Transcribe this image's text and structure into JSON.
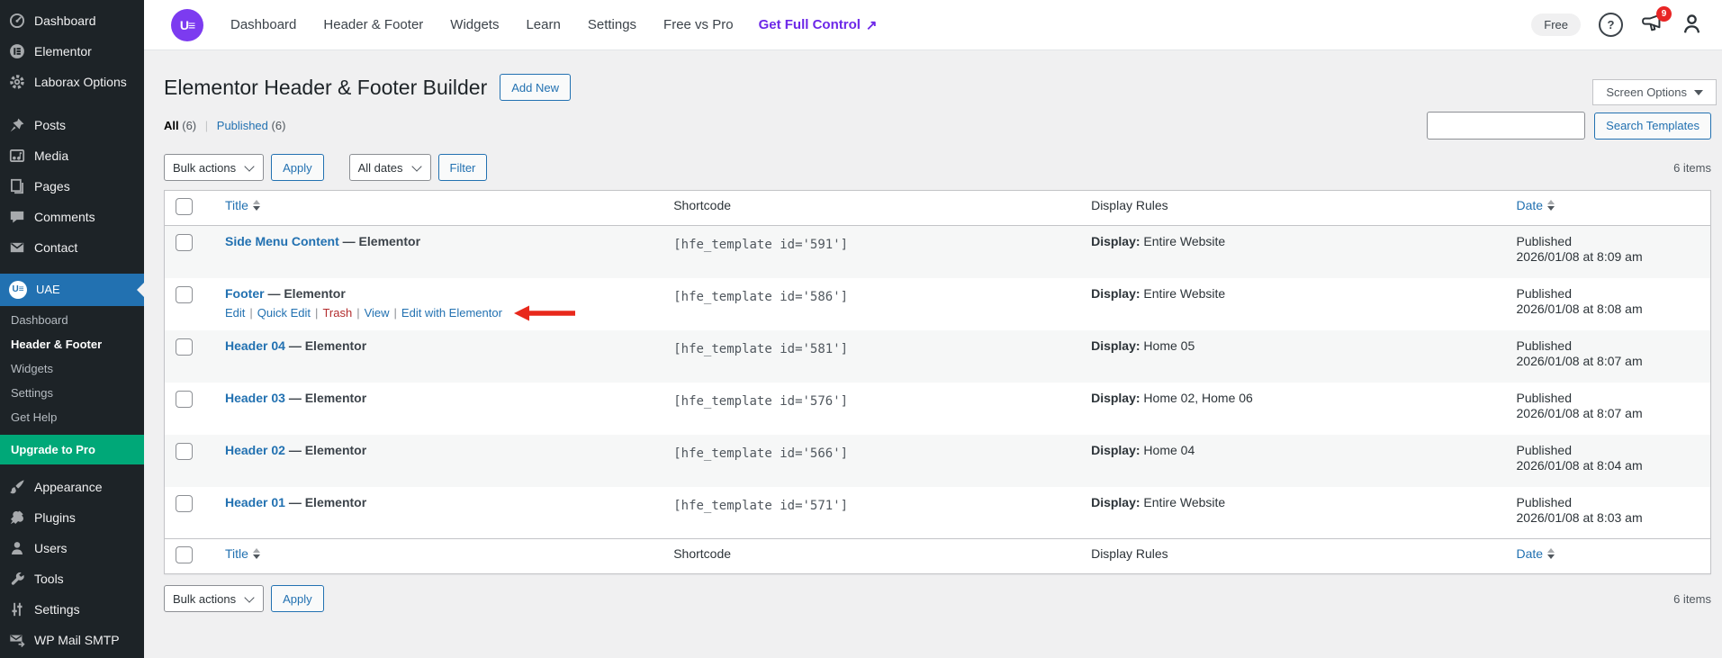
{
  "colors": {
    "accent": "#2271b1",
    "purple": "#7c3bf0",
    "purple_text": "#6d28e8",
    "green": "#00a878",
    "red_badge": "#e82525",
    "red_arrow": "#e8291c",
    "danger": "#b32d2e",
    "sidebar_bg": "#1d2327"
  },
  "admin_bar": {
    "logo_glyph": "U≡",
    "nav": [
      {
        "label": "Dashboard"
      },
      {
        "label": "Header & Footer"
      },
      {
        "label": "Widgets"
      },
      {
        "label": "Learn"
      },
      {
        "label": "Settings"
      },
      {
        "label": "Free vs Pro"
      }
    ],
    "cta": "Get Full Control",
    "cta_arrow": "↗",
    "free_badge": "Free",
    "help_glyph": "?",
    "notification_count": "9"
  },
  "sidebar": {
    "group1": [
      {
        "label": "Dashboard",
        "icon": "gauge-icon"
      },
      {
        "label": "Elementor",
        "icon": "elementor-icon"
      },
      {
        "label": "Laborax Options",
        "icon": "gear-icon"
      }
    ],
    "group2": [
      {
        "label": "Posts",
        "icon": "pin-icon"
      },
      {
        "label": "Media",
        "icon": "media-icon"
      },
      {
        "label": "Pages",
        "icon": "pages-icon"
      },
      {
        "label": "Comments",
        "icon": "comment-icon"
      },
      {
        "label": "Contact",
        "icon": "mail-icon"
      }
    ],
    "uae": {
      "label": "UAE",
      "logo_glyph": "U≡"
    },
    "uae_submenu": [
      {
        "label": "Dashboard"
      },
      {
        "label": "Header & Footer",
        "current": true
      },
      {
        "label": "Widgets"
      },
      {
        "label": "Settings"
      },
      {
        "label": "Get Help"
      },
      {
        "label": "Upgrade to Pro",
        "upgrade": true
      }
    ],
    "group3": [
      {
        "label": "Appearance",
        "icon": "brush-icon"
      },
      {
        "label": "Plugins",
        "icon": "plug-icon"
      },
      {
        "label": "Users",
        "icon": "person-icon"
      },
      {
        "label": "Tools",
        "icon": "wrench-icon"
      },
      {
        "label": "Settings",
        "icon": "sliders-icon"
      },
      {
        "label": "WP Mail SMTP",
        "icon": "mail-arrow-icon"
      }
    ]
  },
  "page": {
    "title": "Elementor Header & Footer Builder",
    "add_new": "Add New",
    "screen_options": "Screen Options",
    "all_label": "All",
    "all_count": "(6)",
    "published_label": "Published",
    "published_count": "(6)",
    "search_button": "Search Templates",
    "bulk_actions": "Bulk actions",
    "apply": "Apply",
    "all_dates": "All dates",
    "filter": "Filter",
    "items_count": "6 items"
  },
  "table": {
    "headers": {
      "title": "Title",
      "shortcode": "Shortcode",
      "display_rules": "Display Rules",
      "date": "Date"
    },
    "rows": [
      {
        "title": "Side Menu Content",
        "suffix": "— Elementor",
        "shortcode": "[hfe_template id='591']",
        "display_label": "Display:",
        "display_value": "Entire Website",
        "status": "Published",
        "date": "2026/01/08 at 8:09 am"
      },
      {
        "title": "Footer",
        "suffix": "— Elementor",
        "shortcode": "[hfe_template id='586']",
        "display_label": "Display:",
        "display_value": "Entire Website",
        "status": "Published",
        "date": "2026/01/08 at 8:08 am",
        "annotated": true,
        "actions": [
          {
            "label": "Edit"
          },
          {
            "label": "Quick Edit"
          },
          {
            "label": "Trash",
            "danger": true
          },
          {
            "label": "View"
          },
          {
            "label": "Edit with Elementor"
          }
        ]
      },
      {
        "title": "Header 04",
        "suffix": "— Elementor",
        "shortcode": "[hfe_template id='581']",
        "display_label": "Display:",
        "display_value": "Home 05",
        "status": "Published",
        "date": "2026/01/08 at 8:07 am"
      },
      {
        "title": "Header 03",
        "suffix": "— Elementor",
        "shortcode": "[hfe_template id='576']",
        "display_label": "Display:",
        "display_value": "Home 02, Home 06",
        "status": "Published",
        "date": "2026/01/08 at 8:07 am"
      },
      {
        "title": "Header 02",
        "suffix": "— Elementor",
        "shortcode": "[hfe_template id='566']",
        "display_label": "Display:",
        "display_value": "Home 04",
        "status": "Published",
        "date": "2026/01/08 at 8:04 am"
      },
      {
        "title": "Header 01",
        "suffix": "— Elementor",
        "shortcode": "[hfe_template id='571']",
        "display_label": "Display:",
        "display_value": "Entire Website",
        "status": "Published",
        "date": "2026/01/08 at 8:03 am"
      }
    ]
  }
}
